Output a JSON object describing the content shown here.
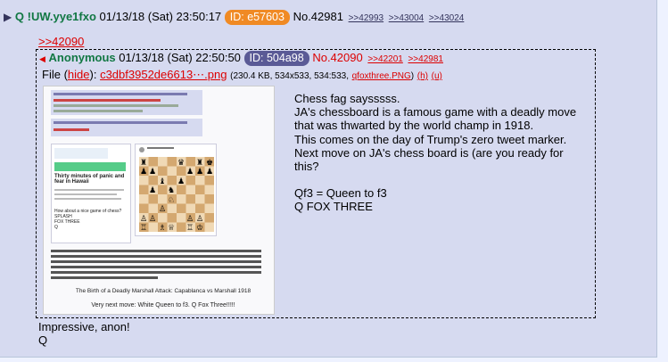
{
  "post": {
    "name": "Q",
    "tripcode": "!UW.yye1fxo",
    "datetime": "01/13/18 (Sat) 23:50:17",
    "id_label": "ID: e57603",
    "number": "No.42981",
    "backlinks": [
      ">>42993",
      ">>43004",
      ">>43024"
    ],
    "quote_link": ">>42090",
    "reply_lines": [
      "Impressive, anon!",
      "Q"
    ]
  },
  "inline": {
    "name": "Anonymous",
    "datetime": "01/13/18 (Sat) 22:50:50",
    "id_label": "ID: 504a98",
    "number": "No.42090",
    "backlinks": [
      ">>42201",
      ">>42981"
    ],
    "file_label": "File",
    "hide_label": "hide",
    "filename": "c3dbf3952de6613⋯.png",
    "file_meta": "(230.4 KB, 534x533, 534:533,",
    "orig_filename": "qfoxthree.PNG",
    "h_label": "(h)",
    "u_label": "(u)",
    "lines": [
      "Chess fag saysssss.",
      "JA's chessboard is a famous game with a deadly move that was thwarted by the world champ in 1918.",
      "This comes on the day of Trump's zero tweet marker.",
      "Next move on JA's chess board is (are you ready for this?",
      "",
      "Qf3 = Queen to f3",
      "Q FOX THREE"
    ]
  },
  "thumbnail": {
    "caption": "The Birth of a Deadly Marshall Attack: Capablanca vs Marshall 1918",
    "footer": "Very next move: White Queen to f3. Q Fox Three!!!!!",
    "tweet_headline": "Thirty minutes of panic and fear in Hawaii",
    "tweet_note": "How about a nice game of chess?\nSPLASH\nFOX THREE\nQ"
  },
  "colors": {
    "page_bg": "#eef2ff",
    "post_bg": "#d6daf0",
    "trip_green": "#117743",
    "link_red": "#d00",
    "id_orange": "#f08a24",
    "id_purple": "#5a5a96"
  }
}
